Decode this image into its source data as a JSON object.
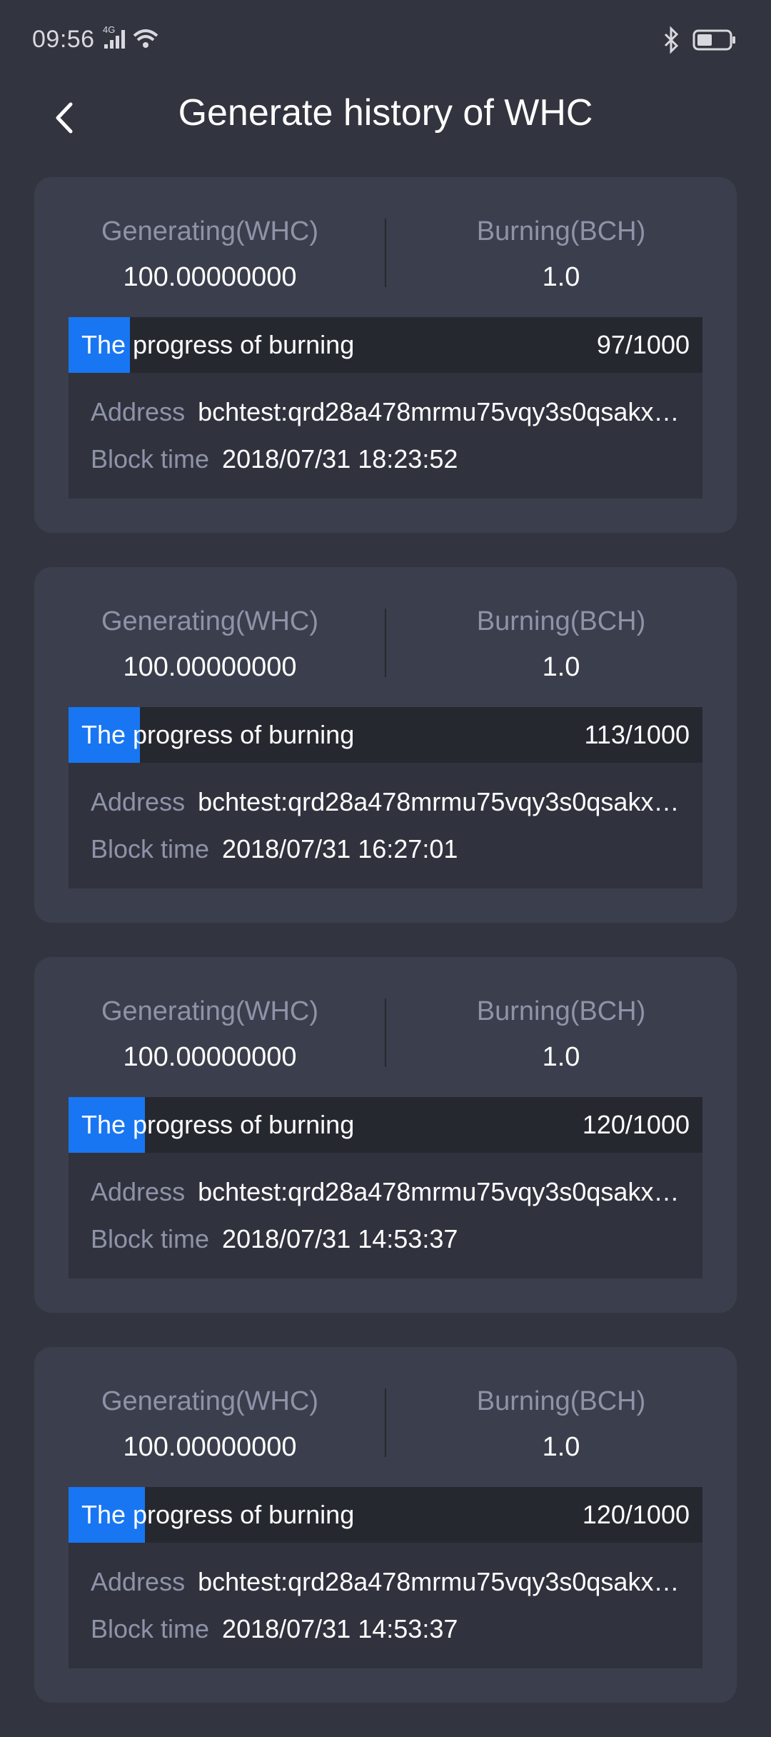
{
  "status_bar": {
    "time": "09:56",
    "network": "4G",
    "icons": [
      "signal-icon",
      "wifi-icon",
      "bluetooth-icon",
      "battery-icon"
    ]
  },
  "header": {
    "title": "Generate history of WHC",
    "back_icon": "chevron-left-icon"
  },
  "colors": {
    "background": "#32353f",
    "card": "#3b3e4c",
    "progress_track": "#262830",
    "progress_fill": "#1876f2",
    "label": "#8f93a8"
  },
  "records": [
    {
      "generating_label": "Generating(WHC)",
      "generating_value": "100.00000000",
      "burning_label": "Burning(BCH)",
      "burning_value": "1.0",
      "progress_label": "The progress of burning",
      "progress_count": "97/1000",
      "progress_fraction": 0.097,
      "address_label": "Address",
      "address_value": "bchtest:qrd28a478mrmu75vqy3s0qsakx…",
      "block_time_label": "Block time",
      "block_time_value": "2018/07/31 18:23:52"
    },
    {
      "generating_label": "Generating(WHC)",
      "generating_value": "100.00000000",
      "burning_label": "Burning(BCH)",
      "burning_value": "1.0",
      "progress_label": "The progress of burning",
      "progress_count": "113/1000",
      "progress_fraction": 0.113,
      "address_label": "Address",
      "address_value": "bchtest:qrd28a478mrmu75vqy3s0qsakx…",
      "block_time_label": "Block time",
      "block_time_value": "2018/07/31 16:27:01"
    },
    {
      "generating_label": "Generating(WHC)",
      "generating_value": "100.00000000",
      "burning_label": "Burning(BCH)",
      "burning_value": "1.0",
      "progress_label": "The progress of burning",
      "progress_count": "120/1000",
      "progress_fraction": 0.12,
      "address_label": "Address",
      "address_value": "bchtest:qrd28a478mrmu75vqy3s0qsakx…",
      "block_time_label": "Block time",
      "block_time_value": "2018/07/31 14:53:37"
    },
    {
      "generating_label": "Generating(WHC)",
      "generating_value": "100.00000000",
      "burning_label": "Burning(BCH)",
      "burning_value": "1.0",
      "progress_label": "The progress of burning",
      "progress_count": "120/1000",
      "progress_fraction": 0.12,
      "address_label": "Address",
      "address_value": "bchtest:qrd28a478mrmu75vqy3s0qsakx…",
      "block_time_label": "Block time",
      "block_time_value": "2018/07/31 14:53:37"
    }
  ]
}
